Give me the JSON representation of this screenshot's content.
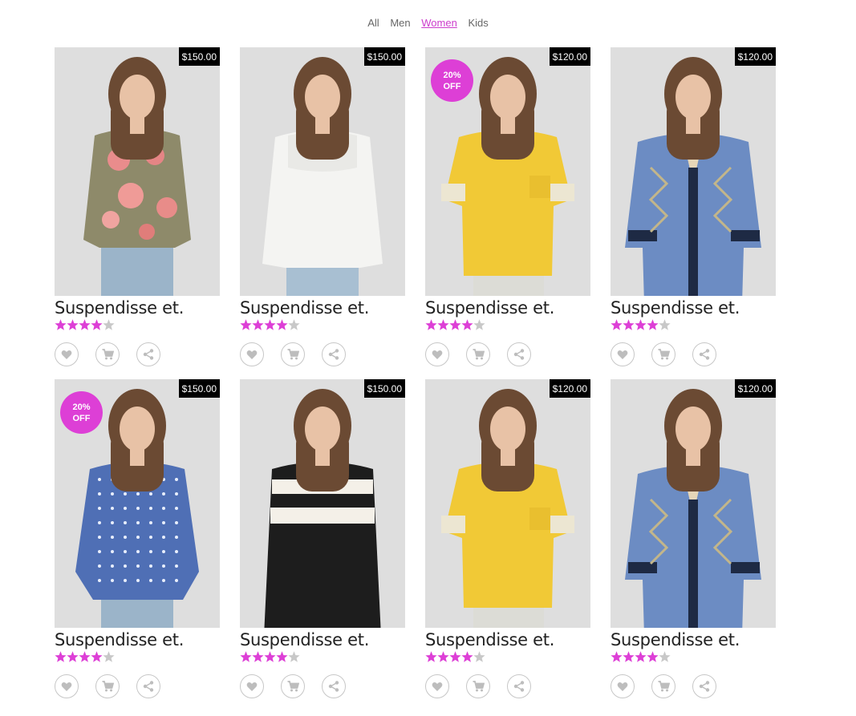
{
  "filters": {
    "all": "All",
    "men": "Men",
    "women": "Women",
    "kids": "Kids",
    "active": "women"
  },
  "colors": {
    "accent": "#dd3fd6",
    "star_empty": "#c8c8c8",
    "price_bg": "#000000"
  },
  "products": [
    {
      "title": "Suspendisse et.",
      "price": "$150.00",
      "rating": 4,
      "sale": null,
      "garment": "floral-blouse"
    },
    {
      "title": "Suspendisse et.",
      "price": "$150.00",
      "rating": 4,
      "sale": null,
      "garment": "white-lace-blouse"
    },
    {
      "title": "Suspendisse et.",
      "price": "$120.00",
      "rating": 4,
      "sale": {
        "line1": "20%",
        "line2": "OFF"
      },
      "garment": "yellow-tee"
    },
    {
      "title": "Suspendisse et.",
      "price": "$120.00",
      "rating": 4,
      "sale": null,
      "garment": "blue-batik-top"
    },
    {
      "title": "Suspendisse et.",
      "price": "$150.00",
      "rating": 4,
      "sale": {
        "line1": "20%",
        "line2": "OFF"
      },
      "garment": "blue-polka-shirt"
    },
    {
      "title": "Suspendisse et.",
      "price": "$150.00",
      "rating": 4,
      "sale": null,
      "garment": "black-white-stripe-dress"
    },
    {
      "title": "Suspendisse et.",
      "price": "$120.00",
      "rating": 4,
      "sale": null,
      "garment": "yellow-tee"
    },
    {
      "title": "Suspendisse et.",
      "price": "$120.00",
      "rating": 4,
      "sale": null,
      "garment": "blue-batik-top"
    }
  ],
  "action_icons": [
    "heart-icon",
    "cart-icon",
    "share-icon"
  ]
}
